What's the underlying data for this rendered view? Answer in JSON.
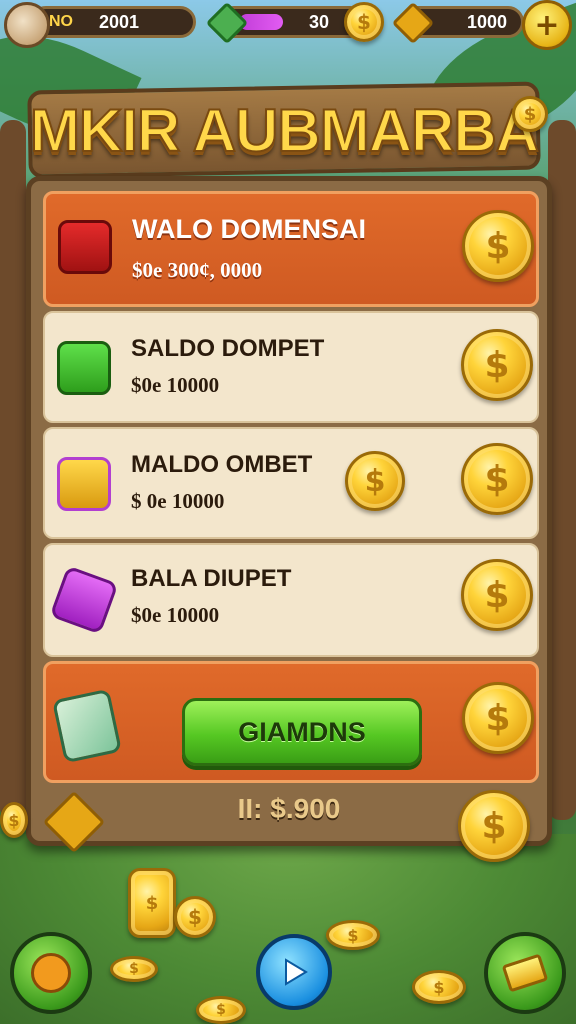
{
  "hud": {
    "level_label": "NO",
    "level_value": "2001",
    "energy_value": "30",
    "energy_fraction": 0.5,
    "gold_value": "1000",
    "add_label": "+"
  },
  "title": "MKIR AUBMARBA",
  "rows": [
    {
      "title": "WALO DOMENSAI",
      "value": "$0e 300¢, 0000"
    },
    {
      "title": "SALDO DOMPET",
      "value": "$0e 10000"
    },
    {
      "title": "MALDO OMBET",
      "value": "$ 0e 10000"
    },
    {
      "title": "BALA DIUPET",
      "value": "$0e 10000"
    }
  ],
  "cta_label": "GIAMDNS",
  "total_label": "II: $.900",
  "icons": {
    "coin": "dollar-coin-icon",
    "gift": "gift-box-icon",
    "wallet": "green-wallet-icon",
    "card": "gold-card-icon",
    "ticket": "purple-ticket-icon",
    "cash": "cash-stack-icon",
    "play": "play-icon"
  },
  "colors": {
    "accent_orange": "#e06a2a",
    "panel_cream": "#f3e6cc",
    "button_green": "#56c823",
    "title_gold": "#ffd84a"
  }
}
